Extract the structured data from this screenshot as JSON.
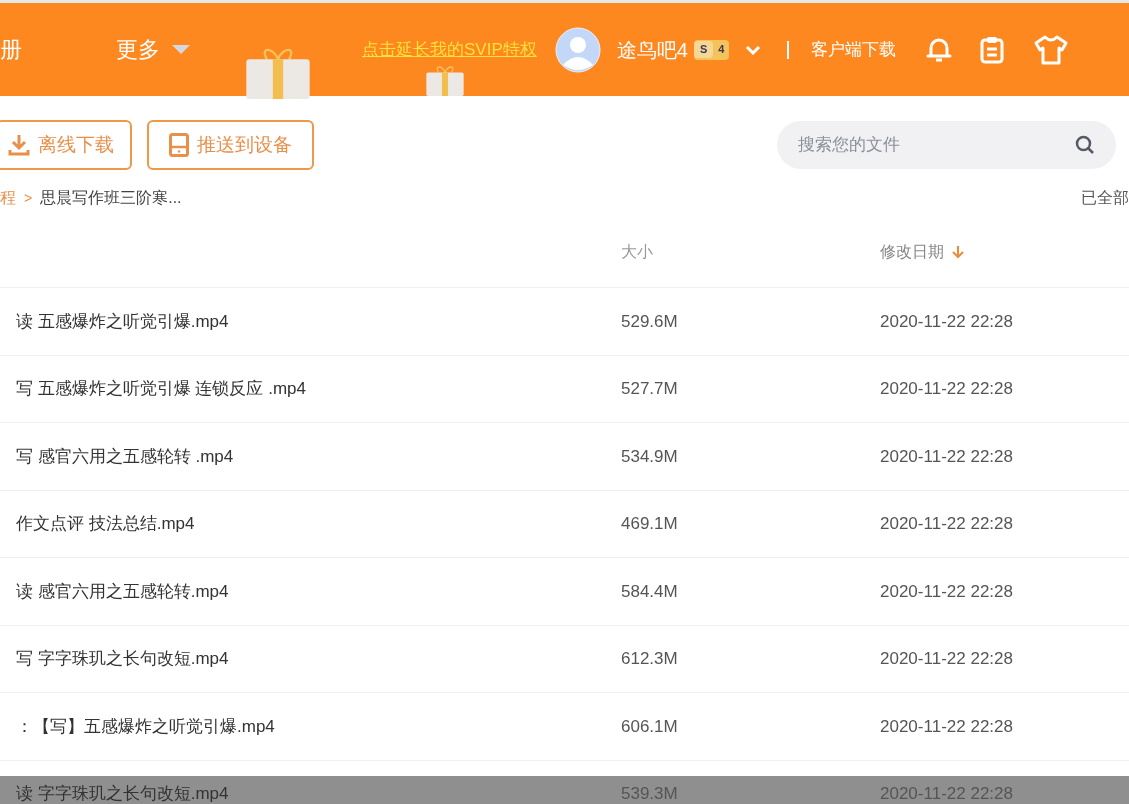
{
  "header": {
    "nav": [
      {
        "label": "册",
        "kind": "link"
      },
      {
        "label": "更多",
        "kind": "dropdown"
      }
    ],
    "promo": "点击延长我的SVIP特权",
    "user": {
      "name": "途鸟吧4",
      "badge_s": "S",
      "badge_level": "4"
    },
    "client_download": "客户端下载"
  },
  "toolbar": {
    "buttons": [
      {
        "label": "离线下载",
        "kind": "download"
      },
      {
        "label": "推送到设备",
        "kind": "device"
      }
    ],
    "search": {
      "placeholder": "搜索您的文件"
    }
  },
  "breadcrumb": {
    "items": [
      "程",
      "思晨写作班三阶寒..."
    ],
    "separator": ">",
    "status": "已全部"
  },
  "table": {
    "columns": [
      {
        "label": "大小",
        "sorted": false
      },
      {
        "label": "修改日期",
        "sorted": true
      }
    ],
    "rows": [
      {
        "name": "读 五感爆炸之听觉引爆.mp4",
        "size": "529.6M",
        "date": "2020-11-22 22:28"
      },
      {
        "name": "写 五感爆炸之听觉引爆 连锁反应 .mp4",
        "size": "527.7M",
        "date": "2020-11-22 22:28"
      },
      {
        "name": "写 感官六用之五感轮转 .mp4",
        "size": "534.9M",
        "date": "2020-11-22 22:28"
      },
      {
        "name": "作文点评 技法总结.mp4",
        "size": "469.1M",
        "date": "2020-11-22 22:28"
      },
      {
        "name": "读 感官六用之五感轮转.mp4",
        "size": "584.4M",
        "date": "2020-11-22 22:28"
      },
      {
        "name": "写 字字珠玑之长句改短.mp4",
        "size": "612.3M",
        "date": "2020-11-22 22:28"
      },
      {
        "name": "：【写】五感爆炸之听觉引爆.mp4",
        "size": "606.1M",
        "date": "2020-11-22 22:28"
      },
      {
        "name": "读 字字珠玑之长句改短.mp4",
        "size": "539.3M",
        "date": "2020-11-22 22:28"
      }
    ]
  }
}
